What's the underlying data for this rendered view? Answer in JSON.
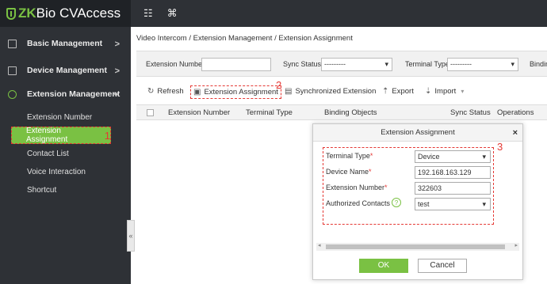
{
  "app": {
    "brand_prefix": "ZK",
    "brand_suffix": "Bio CVAccess"
  },
  "topbar": {
    "icons": [
      "grid-icon",
      "command-icon"
    ],
    "glyphs": [
      "☷",
      "⌘"
    ]
  },
  "sidebar": {
    "groups": [
      {
        "label": "Basic Management",
        "arrow": ">"
      },
      {
        "label": "Device Management",
        "arrow": ">"
      },
      {
        "label": "Extension Management",
        "arrow": "⌄"
      }
    ],
    "items": [
      {
        "label": "Extension Number"
      },
      {
        "label": "Extension Assignment",
        "callout": "1"
      },
      {
        "label": "Contact List"
      },
      {
        "label": "Voice Interaction"
      },
      {
        "label": "Shortcut"
      }
    ],
    "collapse_glyph": "«"
  },
  "breadcrumb": "Video Intercom / Extension Management / Extension Assignment",
  "filter": {
    "extension_number_label": "Extension Number",
    "extension_number_value": "",
    "sync_status_label": "Sync Status",
    "sync_status_value": "---------",
    "terminal_type_label": "Terminal Type",
    "terminal_type_value": "---------",
    "binding_label": "Bindin"
  },
  "toolbar": {
    "refresh": "Refresh",
    "assign": "Extension Assignment",
    "assign_callout": "2",
    "sync": "Synchronized Extension",
    "export": "Export",
    "import": "Import"
  },
  "table": {
    "columns": [
      "Extension Number",
      "Terminal Type",
      "Binding Objects",
      "Sync Status",
      "Operations"
    ]
  },
  "dialog": {
    "title": "Extension Assignment",
    "close": "×",
    "callout": "3",
    "fields": [
      {
        "label": "Terminal Type",
        "required": "*",
        "value": "Device"
      },
      {
        "label": "Device Name",
        "required": "*",
        "value": "192.168.163.129"
      },
      {
        "label": "Extension Number",
        "required": "*",
        "value": "322603"
      },
      {
        "label": "Authorized Contacts",
        "required": "",
        "help": "?",
        "value": "test"
      }
    ],
    "ok": "OK",
    "cancel": "Cancel"
  },
  "colors": {
    "accent": "#7ac143",
    "sidebar_bg": "#2e3136",
    "highlight_red": "#e53935"
  }
}
